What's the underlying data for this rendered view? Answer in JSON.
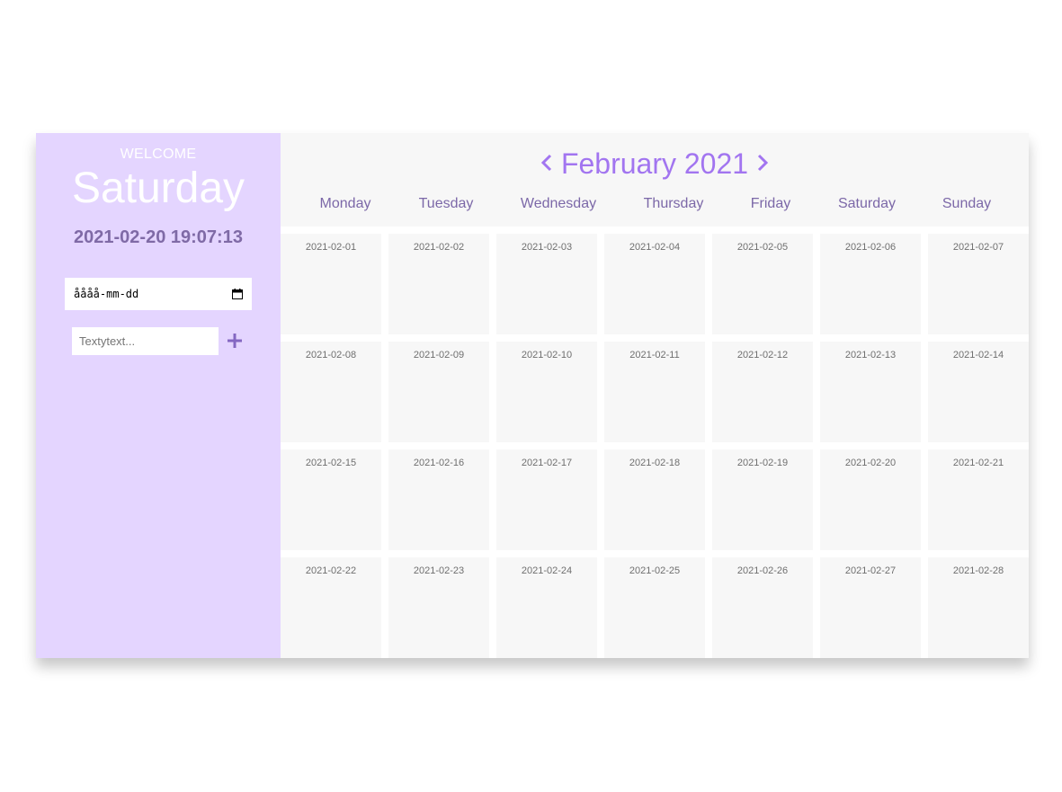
{
  "sidebar": {
    "welcome": "WELCOME",
    "day_name": "Saturday",
    "datetime": "2021-02-20 19:07:13",
    "date_input_value": "åååå-mm-dd",
    "text_input_placeholder": "Textytext...",
    "add_icon": "plus-icon"
  },
  "calendar": {
    "month_title": "February 2021",
    "prev_icon": "chevron-left-icon",
    "next_icon": "chevron-right-icon",
    "weekdays": [
      "Monday",
      "Tuesday",
      "Wednesday",
      "Thursday",
      "Friday",
      "Saturday",
      "Sunday"
    ],
    "days": [
      "2021-02-01",
      "2021-02-02",
      "2021-02-03",
      "2021-02-04",
      "2021-02-05",
      "2021-02-06",
      "2021-02-07",
      "2021-02-08",
      "2021-02-09",
      "2021-02-10",
      "2021-02-11",
      "2021-02-12",
      "2021-02-13",
      "2021-02-14",
      "2021-02-15",
      "2021-02-16",
      "2021-02-17",
      "2021-02-18",
      "2021-02-19",
      "2021-02-20",
      "2021-02-21",
      "2021-02-22",
      "2021-02-23",
      "2021-02-24",
      "2021-02-25",
      "2021-02-26",
      "2021-02-27",
      "2021-02-28"
    ]
  },
  "colors": {
    "sidebar_bg": "#e4d5ff",
    "accent": "#a275f0",
    "weekday_text": "#7c68a8",
    "datetime_text": "#7f6aa6",
    "cell_bg": "#f7f7f7"
  }
}
